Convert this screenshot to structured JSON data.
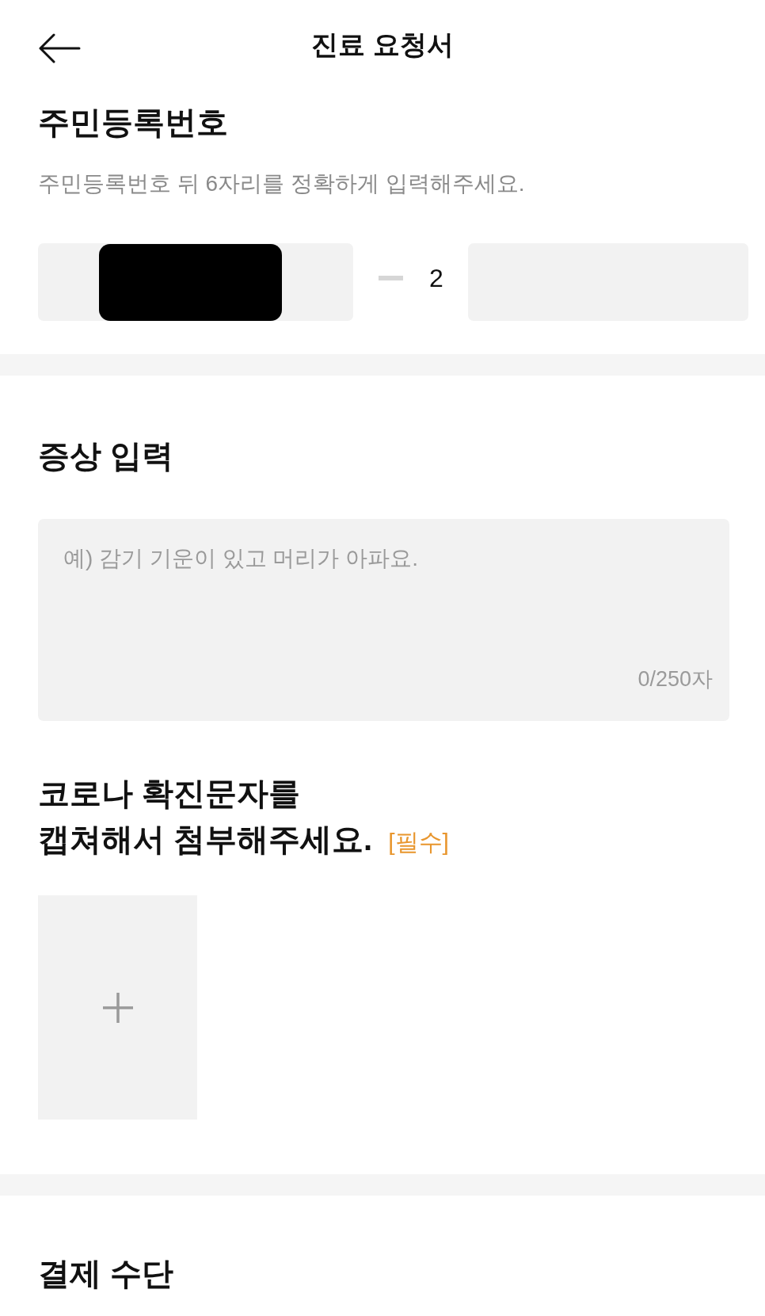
{
  "header": {
    "title": "진료 요청서"
  },
  "resident_number": {
    "title": "주민등록번호",
    "description": "주민등록번호 뒤 6자리를 정확하게 입력해주세요.",
    "front_field": {
      "redacted": true
    },
    "gender_digit": "2"
  },
  "symptoms": {
    "title": "증상 입력",
    "placeholder": "예) 감기 기운이 있고 머리가 아파요.",
    "counter": "0/250자"
  },
  "attachment": {
    "title": "코로나 확진문자를\n캡쳐해서 첨부해주세요.",
    "required_tag": "[필수]"
  },
  "payment": {
    "title": "결제 수단"
  }
}
